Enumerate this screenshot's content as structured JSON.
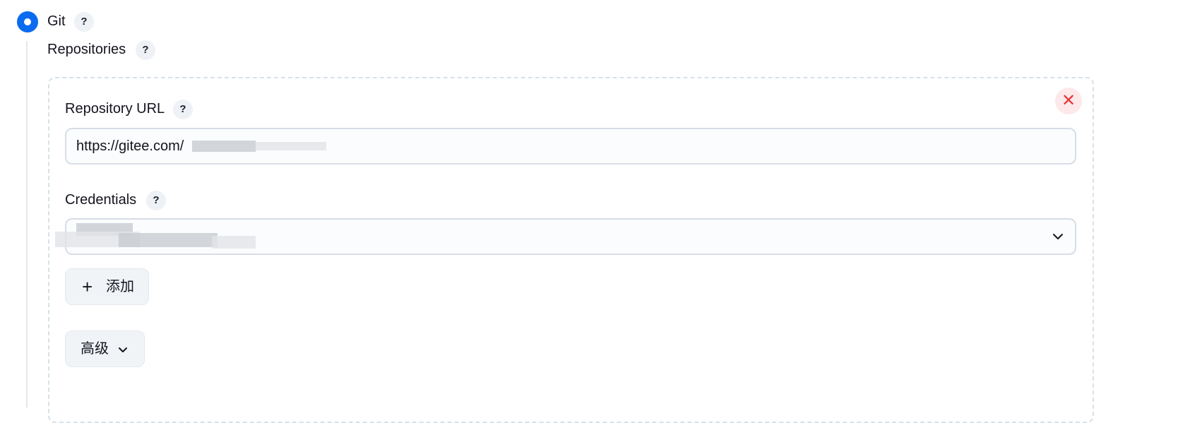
{
  "scm": {
    "option_label": "Git",
    "help_glyph": "?",
    "repositories_label": "Repositories",
    "repository_url_label": "Repository URL",
    "repository_url_value": "https://gitee.com/",
    "credentials_label": "Credentials",
    "remove_glyph": "✕",
    "add_button_label": "添加",
    "add_button_glyph": "+",
    "advanced_button_label": "高级"
  },
  "colors": {
    "accent": "#0b6bf0",
    "remove": "#e5383b"
  },
  "icons": {
    "radio": "radio-selected-icon",
    "help": "help-icon",
    "remove": "close-icon",
    "add": "plus-icon",
    "dropdown": "chevron-down-icon"
  }
}
